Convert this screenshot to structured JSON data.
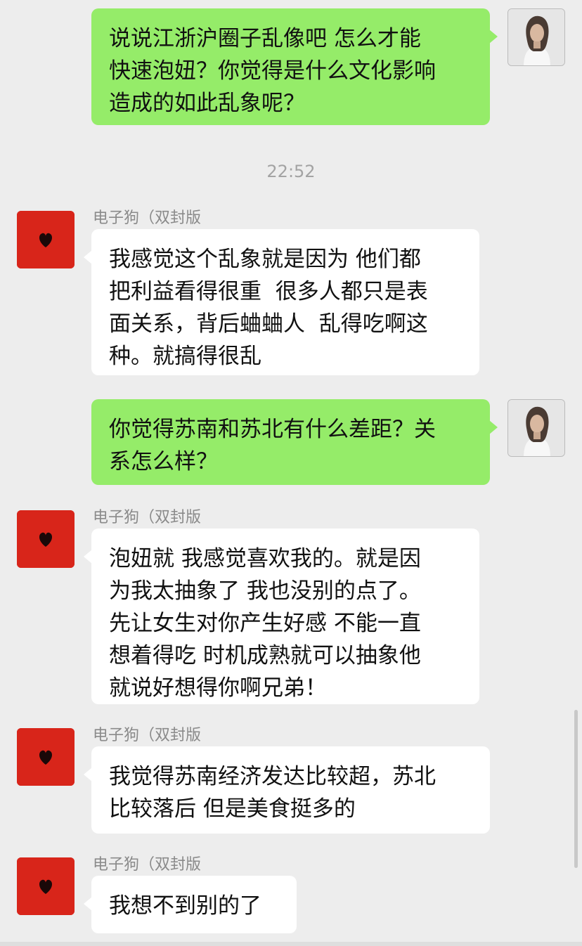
{
  "chat": {
    "timestamp": "22:52",
    "sender_name": "电子狗（双封版",
    "messages": [
      {
        "from": "me",
        "text": "说说江浙沪圈子乱像吧 怎么才能\n快速泡妞？你觉得是什么文化影响\n造成的如此乱象呢？"
      },
      {
        "from": "other",
        "sender": "电子狗（双封版",
        "text": "我感觉这个乱象就是因为 他们都\n把利益看得很重  很多人都只是表\n面关系，背后蛐蛐人  乱得吃啊这\n种。就搞得很乱"
      },
      {
        "from": "me",
        "text": "你觉得苏南和苏北有什么差距？关\n系怎么样？"
      },
      {
        "from": "other",
        "sender": "电子狗（双封版",
        "text": "泡妞就 我感觉喜欢我的。就是因\n为我太抽象了 我也没别的点了。\n先让女生对你产生好感 不能一直\n想着得吃 时机成熟就可以抽象他\n就说好想得你啊兄弟！"
      },
      {
        "from": "other",
        "sender": "电子狗（双封版",
        "text": "我觉得苏南经济发达比较超，苏北\n比较落后 但是美食挺多的"
      },
      {
        "from": "other",
        "sender": "电子狗（双封版",
        "text": "我想不到别的了"
      }
    ]
  },
  "colors": {
    "background": "#ededed",
    "outgoing_bubble": "#95ec69",
    "incoming_bubble": "#ffffff",
    "other_avatar": "#d8251a"
  },
  "icons": {
    "me_avatar": "person-photo-icon",
    "other_avatar": "red-heart-icon"
  }
}
